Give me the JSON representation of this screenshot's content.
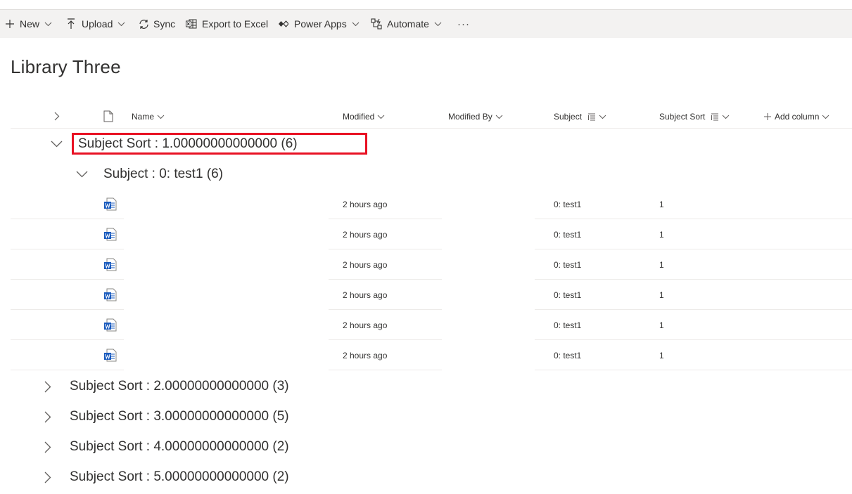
{
  "commandbar": {
    "new_label": "New",
    "upload_label": "Upload",
    "sync_label": "Sync",
    "export_label": "Export to Excel",
    "powerapps_label": "Power Apps",
    "automate_label": "Automate",
    "more_label": "···"
  },
  "page": {
    "title": "Library Three"
  },
  "columns": {
    "name": "Name",
    "modified": "Modified",
    "modified_by": "Modified By",
    "subject": "Subject",
    "subject_sort": "Subject Sort",
    "add_column": "Add column"
  },
  "groups": {
    "expanded": {
      "label": "Subject Sort : 1.00000000000000 (6)",
      "subgroup_label": "Subject : 0: test1 (6)",
      "rows": [
        {
          "modified": "2 hours ago",
          "subject": "0: test1",
          "subject_sort": "1"
        },
        {
          "modified": "2 hours ago",
          "subject": "0: test1",
          "subject_sort": "1"
        },
        {
          "modified": "2 hours ago",
          "subject": "0: test1",
          "subject_sort": "1"
        },
        {
          "modified": "2 hours ago",
          "subject": "0: test1",
          "subject_sort": "1"
        },
        {
          "modified": "2 hours ago",
          "subject": "0: test1",
          "subject_sort": "1"
        },
        {
          "modified": "2 hours ago",
          "subject": "0: test1",
          "subject_sort": "1"
        }
      ]
    },
    "collapsed": [
      {
        "label": "Subject Sort : 2.00000000000000 (3)"
      },
      {
        "label": "Subject Sort : 3.00000000000000 (5)"
      },
      {
        "label": "Subject Sort : 4.00000000000000 (2)"
      },
      {
        "label": "Subject Sort : 5.00000000000000 (2)"
      }
    ]
  },
  "colors": {
    "highlight": "#e81123",
    "word_blue": "#185abd",
    "text": "#323130"
  },
  "icons": [
    "add-icon",
    "upload-icon",
    "sync-icon",
    "excel-icon",
    "power-apps-icon",
    "automate-icon",
    "more-icon",
    "file-icon",
    "word-icon",
    "chevron-right-icon",
    "chevron-down-icon",
    "sort-icon"
  ]
}
